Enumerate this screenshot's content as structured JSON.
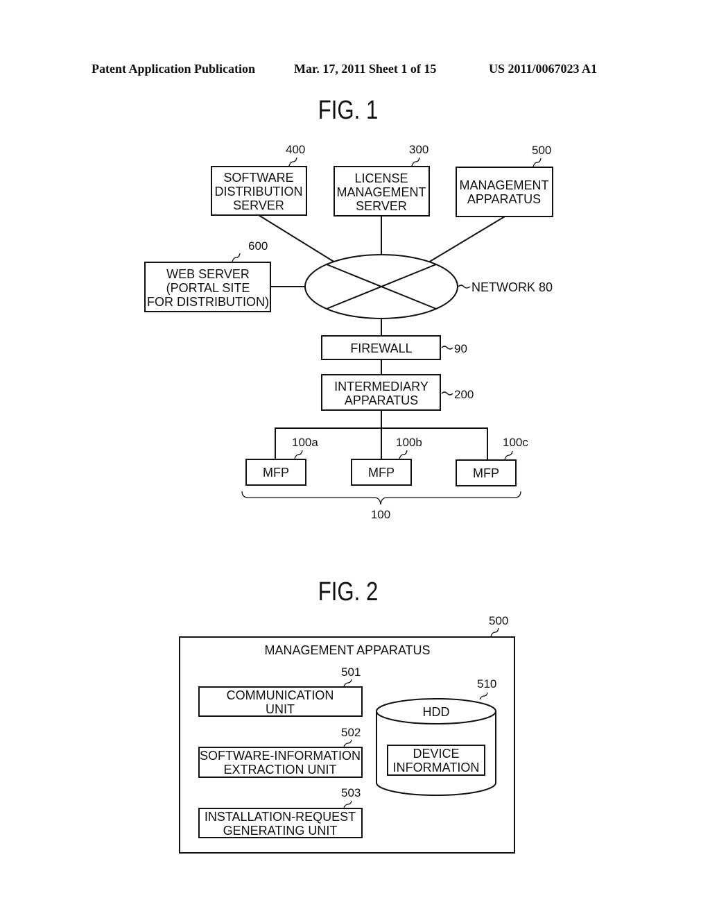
{
  "header": {
    "publication": "Patent Application Publication",
    "date_sheet": "Mar. 17, 2011  Sheet 1 of 15",
    "number": "US 2011/0067023 A1"
  },
  "fig1": {
    "title": "FIG. 1",
    "software_distribution_server": {
      "ref": "400",
      "lines": [
        "SOFTWARE",
        "DISTRIBUTION",
        "SERVER"
      ]
    },
    "license_management_server": {
      "ref": "300",
      "lines": [
        "LICENSE",
        "MANAGEMENT",
        "SERVER"
      ]
    },
    "management_apparatus": {
      "ref": "500",
      "lines": [
        "MANAGEMENT",
        "APPARATUS"
      ]
    },
    "web_server": {
      "ref": "600",
      "lines": [
        "WEB SERVER",
        "(PORTAL SITE",
        "FOR DISTRIBUTION)"
      ]
    },
    "network": {
      "label": "NETWORK 80"
    },
    "firewall": {
      "ref": "90",
      "lines": [
        "FIREWALL"
      ]
    },
    "intermediary_apparatus": {
      "ref": "200",
      "lines": [
        "INTERMEDIARY",
        "APPARATUS"
      ]
    },
    "mfps": [
      {
        "ref": "100a",
        "label": "MFP"
      },
      {
        "ref": "100b",
        "label": "MFP"
      },
      {
        "ref": "100c",
        "label": "MFP"
      }
    ],
    "mfp_group_ref": "100"
  },
  "fig2": {
    "title": "FIG. 2",
    "container": {
      "ref": "500",
      "title": "MANAGEMENT APPARATUS"
    },
    "units": [
      {
        "ref": "501",
        "lines": [
          "COMMUNICATION",
          "UNIT"
        ]
      },
      {
        "ref": "502",
        "lines": [
          "SOFTWARE-INFORMATION",
          "EXTRACTION UNIT"
        ]
      },
      {
        "ref": "503",
        "lines": [
          "INSTALLATION-REQUEST",
          "GENERATING UNIT"
        ]
      }
    ],
    "hdd": {
      "ref": "510",
      "label": "HDD",
      "inner_lines": [
        "DEVICE",
        "INFORMATION"
      ]
    }
  }
}
